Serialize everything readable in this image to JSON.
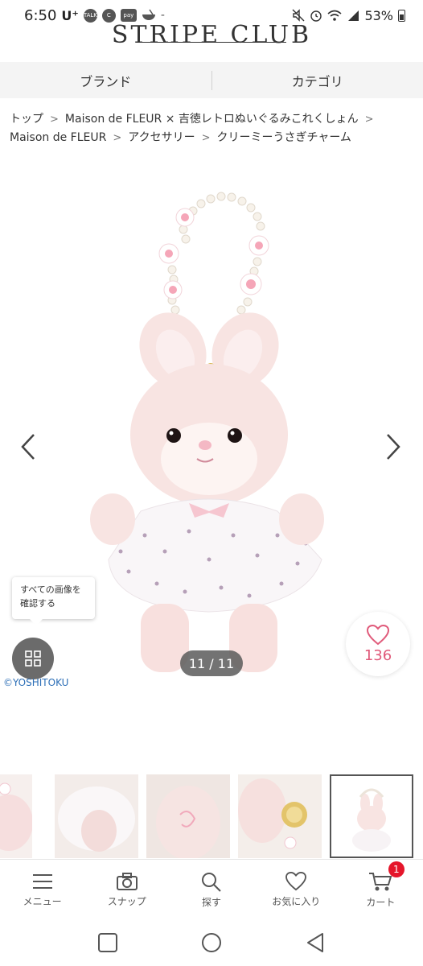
{
  "status_bar": {
    "time": "6:50",
    "carrier": "U⁺",
    "notif_talk": "TALK",
    "notif_c": "C",
    "notif_pay": "pay",
    "notif_more": "-",
    "battery": "53%"
  },
  "header": {
    "logo": "STRIPE CLUB"
  },
  "tabs": [
    {
      "label": "ブランド"
    },
    {
      "label": "カテゴリ"
    }
  ],
  "breadcrumb": {
    "items": [
      "トップ",
      "Maison de FLEUR × 吉徳レトロぬいぐるみこれくしょん",
      "Maison de FLEUR",
      "アクセサリー",
      "クリーミーうさぎチャーム"
    ],
    "separator": ">"
  },
  "gallery": {
    "counter": "11 / 11",
    "tooltip_line1": "すべての画像を",
    "tooltip_line2": "確認する",
    "copyright": "©YOSHITOKU",
    "like_count": "136",
    "grid_icon": "grid-icon",
    "heart_icon": "heart-icon"
  },
  "bottom_nav": [
    {
      "label": "メニュー",
      "icon": "menu-icon"
    },
    {
      "label": "スナップ",
      "icon": "camera-icon"
    },
    {
      "label": "探す",
      "icon": "search-icon"
    },
    {
      "label": "お気に入り",
      "icon": "heart-icon"
    },
    {
      "label": "カート",
      "icon": "cart-icon"
    }
  ],
  "cart_count": "1",
  "colors": {
    "accent_pink": "#e05a7a",
    "badge_red": "#e5162b",
    "tab_bg": "#f4f4f4"
  }
}
